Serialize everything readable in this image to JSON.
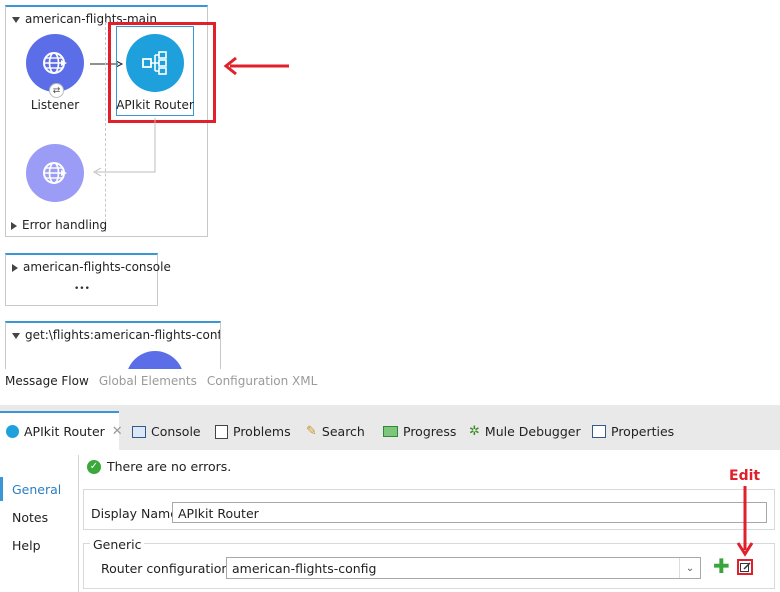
{
  "flows": {
    "main": {
      "title": "american-flights-main",
      "listener_label": "Listener",
      "router_label": "APIkit Router",
      "error_handling_label": "Error handling"
    },
    "console": {
      "title": "american-flights-console",
      "ellipsis": "•••"
    },
    "get_flights": {
      "title": "get:\\flights:american-flights-config"
    }
  },
  "editor_tabs": {
    "message_flow": "Message Flow",
    "global_elements": "Global Elements",
    "configuration_xml": "Configuration XML"
  },
  "panel_tabs": [
    {
      "label": "APIkit Router",
      "icon": "apikit-router-icon"
    },
    {
      "label": "Console",
      "icon": "console-icon"
    },
    {
      "label": "Problems",
      "icon": "problems-icon"
    },
    {
      "label": "Search",
      "icon": "search-icon"
    },
    {
      "label": "Progress",
      "icon": "progress-icon"
    },
    {
      "label": "Mule Debugger",
      "icon": "debugger-icon"
    },
    {
      "label": "Properties",
      "icon": "properties-icon"
    }
  ],
  "status_message": "There are no errors.",
  "sidebar": {
    "items": [
      "General",
      "Notes",
      "Help"
    ],
    "selected": "General"
  },
  "form": {
    "display_name_label": "Display Name:",
    "display_name_value": "APIkit Router",
    "generic_group_label": "Generic",
    "router_config_label": "Router configuration:",
    "router_config_value": "american-flights-config"
  },
  "annotation": {
    "edit_label": "Edit",
    "accent_color": "#e0202a"
  },
  "colors": {
    "accent_blue": "#3a96d4",
    "listener_icon": "#5b6ee8",
    "router_icon": "#1ea0dc",
    "error_icon": "#9b9cf5"
  }
}
